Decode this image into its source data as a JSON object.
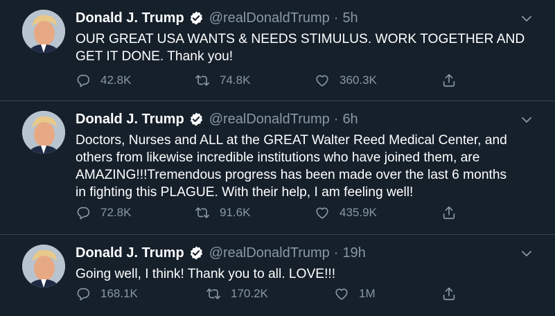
{
  "colors": {
    "background": "#15202b",
    "divider": "#38444d",
    "text": "#ffffff",
    "muted": "#8899a6",
    "verified": "#ffffff"
  },
  "tweets": [
    {
      "name": "Donald J. Trump",
      "handle": "@realDonaldTrump",
      "separator": "·",
      "time": "5h",
      "text": "OUR GREAT USA WANTS & NEEDS STIMULUS. WORK TOGETHER AND\nGET IT DONE. Thank you!",
      "replies": "42.8K",
      "retweets": "74.8K",
      "likes": "360.3K",
      "icons": [
        "reply-icon",
        "retweet-icon",
        "like-icon",
        "share-icon"
      ]
    },
    {
      "name": "Donald J. Trump",
      "handle": "@realDonaldTrump",
      "separator": "·",
      "time": "6h",
      "text": "Doctors, Nurses and ALL at the GREAT Walter Reed Medical Center, and\nothers from likewise incredible institutions who have joined them, are\nAMAZING!!!Tremendous progress has been made over the last 6 months\nin fighting this PLAGUE. With their help, I am feeling well!",
      "replies": "72.8K",
      "retweets": "91.6K",
      "likes": "435.9K",
      "icons": [
        "reply-icon",
        "retweet-icon",
        "like-icon",
        "share-icon"
      ]
    },
    {
      "name": "Donald J. Trump",
      "handle": "@realDonaldTrump",
      "separator": "·",
      "time": "19h",
      "text": "Going well, I think! Thank you to all. LOVE!!!",
      "replies": "168.1K",
      "retweets": "170.2K",
      "likes": "1M",
      "icons": [
        "reply-icon",
        "retweet-icon",
        "like-icon",
        "share-icon"
      ]
    }
  ]
}
